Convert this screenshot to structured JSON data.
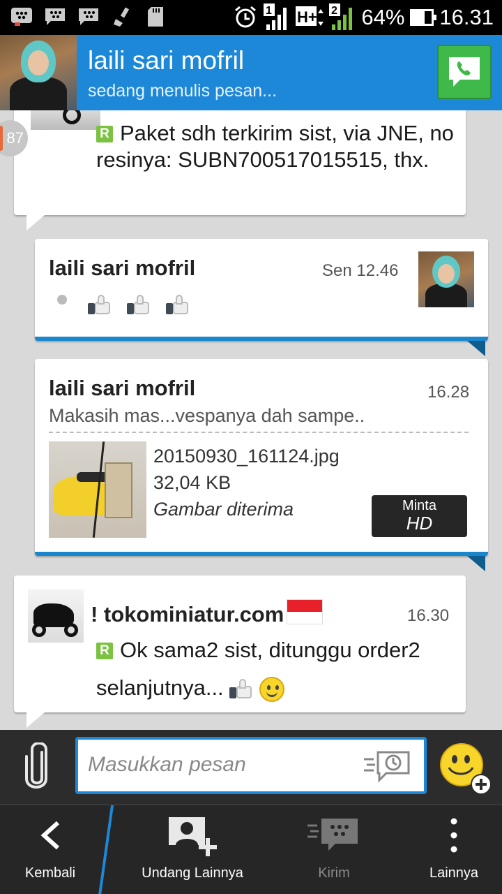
{
  "status_bar": {
    "sim1": "1",
    "sim2": "2",
    "network": "H+",
    "battery_percent": "64%",
    "battery_level": 0.64,
    "time": "16.31"
  },
  "header": {
    "contact_name": "laili sari mofril",
    "status": "sedang menulis pesan..."
  },
  "unread_count": "87",
  "messages": [
    {
      "direction": "incoming",
      "badge": "R",
      "text": "Paket sdh terkirim sist, via JNE, no resinya: SUBN700517015515, thx."
    },
    {
      "direction": "outgoing",
      "sender": "laili sari mofril",
      "time": "Sen 12.46"
    },
    {
      "direction": "outgoing",
      "sender": "laili sari mofril",
      "time": "16.28",
      "caption": "Makasih mas...vespanya dah sampe..",
      "file_name": "20150930_161124.jpg",
      "file_size": "32,04 KB",
      "file_status": "Gambar diterima",
      "hd_button_line1": "Minta",
      "hd_button_line2": "HD"
    },
    {
      "direction": "incoming",
      "sender": "! tokominiatur.com",
      "time": "16.30",
      "badge": "R",
      "text": "Ok sama2 sist, ditunggu order2 selanjutnya..."
    }
  ],
  "composer": {
    "placeholder": "Masukkan pesan"
  },
  "bottom_nav": {
    "back": "Kembali",
    "invite": "Undang Lainnya",
    "send": "Kirim",
    "more": "Lainnya"
  },
  "colors": {
    "header_blue": "#1e88d8",
    "call_green": "#3fba4a",
    "read_badge_green": "#7cc242"
  }
}
